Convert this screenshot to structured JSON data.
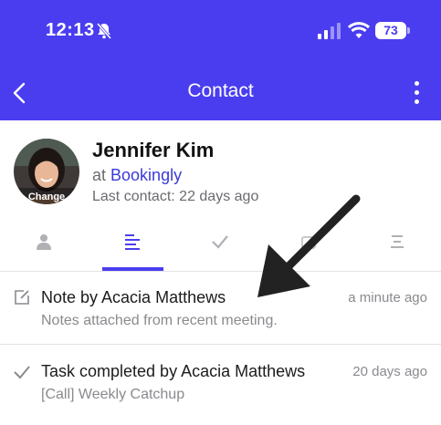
{
  "status_bar": {
    "time": "12:13",
    "battery": "73"
  },
  "nav": {
    "title": "Contact"
  },
  "contact": {
    "name": "Jennifer Kim",
    "company_prefix": "at",
    "company": "Bookingly",
    "last_contact": "Last contact: 22 days ago",
    "avatar_label": "Change"
  },
  "tabs": [
    {
      "icon": "person-icon",
      "active": false
    },
    {
      "icon": "notes-list-icon",
      "active": true
    },
    {
      "icon": "checkmark-icon",
      "active": false
    },
    {
      "icon": "deals-icon",
      "active": false
    },
    {
      "icon": "summary-list-icon",
      "active": false
    }
  ],
  "activities": [
    {
      "icon": "note-edit-icon",
      "title": "Note by Acacia Matthews",
      "subtitle": "Notes attached from recent meeting.",
      "time": "a minute ago"
    },
    {
      "icon": "checkmark-icon",
      "title": "Task completed by Acacia Matthews",
      "subtitle": "[Call] Weekly Catchup",
      "time": "20 days ago"
    }
  ],
  "colors": {
    "accent": "#4a3df0",
    "link": "#3b3ad6"
  }
}
